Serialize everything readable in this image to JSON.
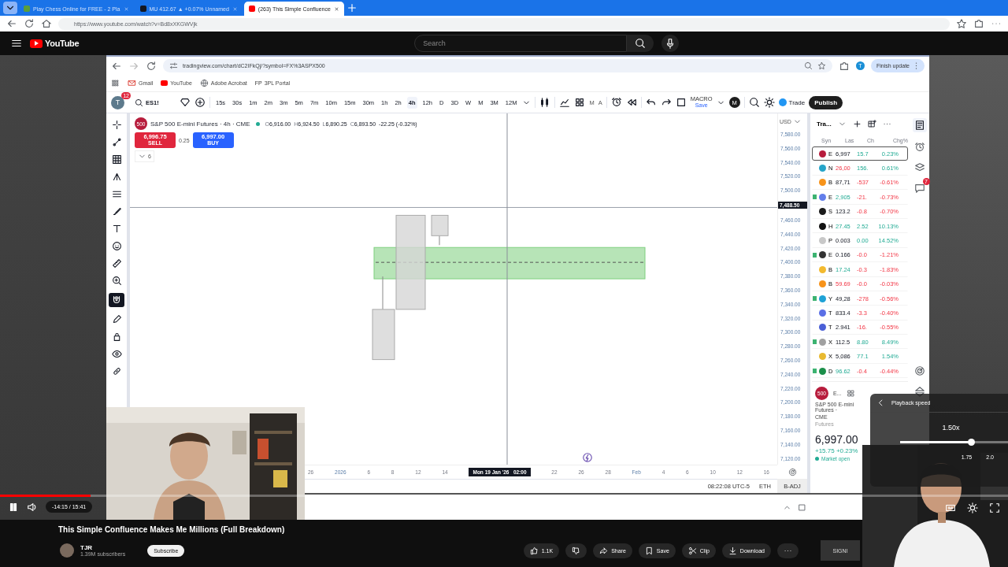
{
  "browser": {
    "tabs": [
      {
        "title": "Play Chess Online for FREE - 2 Pla",
        "selected": false
      },
      {
        "title": "MU 412.67 ▲ +0.07% Unnamed",
        "selected": false
      },
      {
        "title": "(263) This Simple Confluence",
        "selected": true
      }
    ],
    "url": "https://www.youtube.com/watch?v=Bd8xXKGWVjk"
  },
  "youtube": {
    "logo": "YouTube",
    "search_placeholder": "Search"
  },
  "screen": {
    "url": "tradingview.com/chart/dC2IFkQj/?symbol=FX%3ASPX500",
    "avatar": "T",
    "update_button": "Finish update",
    "bookmarks": [
      {
        "kind": "gmail",
        "label": "Gmail"
      },
      {
        "kind": "youtube",
        "label": "YouTube"
      },
      {
        "kind": "globe",
        "label": "Adobe Acrobat"
      },
      {
        "kind": "letters",
        "mark": "FP",
        "label": "3PL Portal"
      }
    ],
    "tv": {
      "avatar": "T",
      "notifications": "12",
      "symbol": "ES1!",
      "intervals": [
        {
          "label": "15s",
          "selected": false
        },
        {
          "label": "30s",
          "selected": false
        },
        {
          "label": "1m",
          "selected": false
        },
        {
          "label": "2m",
          "selected": false
        },
        {
          "label": "3m",
          "selected": false
        },
        {
          "label": "5m",
          "selected": false
        },
        {
          "label": "7m",
          "selected": false
        },
        {
          "label": "10m",
          "selected": false
        },
        {
          "label": "15m",
          "selected": false
        },
        {
          "label": "30m",
          "selected": false
        },
        {
          "label": "1h",
          "selected": false
        },
        {
          "label": "2h",
          "selected": false
        },
        {
          "label": "4h",
          "selected": true
        },
        {
          "label": "12h",
          "selected": false
        },
        {
          "label": "D",
          "selected": false
        },
        {
          "label": "3D",
          "selected": false
        },
        {
          "label": "W",
          "selected": false
        },
        {
          "label": "M",
          "selected": false
        },
        {
          "label": "3M",
          "selected": false
        },
        {
          "label": "12M",
          "selected": false
        }
      ],
      "tool_letters": [
        "M",
        "A"
      ],
      "layout": {
        "name": "MACRO",
        "state": "Save"
      },
      "user_initial": "M",
      "trade": "Trade",
      "publish": "Publish",
      "magnet_on": true,
      "legend": {
        "logo": "500",
        "title": "S&P 500 E-mini Futures · 4h · CME",
        "ohlc": [
          {
            "label": "O",
            "value": "6,916.00"
          },
          {
            "label": "H",
            "value": "6,924.50"
          },
          {
            "label": "L",
            "value": "6,890.25"
          },
          {
            "label": "C",
            "value": "6,893.50"
          }
        ],
        "change": "-22.25 (-0.32%)",
        "sell": {
          "price": "6,996.75",
          "label": "SELL"
        },
        "spread": "0.25",
        "buy": {
          "price": "6,997.00",
          "label": "BUY"
        },
        "indicators": "6"
      },
      "price_axis": {
        "currency": "USD",
        "labels": [
          {
            "text": "7,580.00",
            "kind": "tick"
          },
          {
            "text": "7,560.00",
            "kind": "tick"
          },
          {
            "text": "7,540.00",
            "kind": "tick"
          },
          {
            "text": "7,520.00",
            "kind": "tick"
          },
          {
            "text": "7,500.00",
            "kind": "tick"
          },
          {
            "text": "7,488.50",
            "kind": "cursor"
          },
          {
            "text": "7,460.00",
            "kind": "tick"
          },
          {
            "text": "7,440.00",
            "kind": "tick"
          },
          {
            "text": "7,420.00",
            "kind": "tick"
          },
          {
            "text": "7,400.00",
            "kind": "tick"
          },
          {
            "text": "7,380.00",
            "kind": "tick"
          },
          {
            "text": "7,360.00",
            "kind": "tick"
          },
          {
            "text": "7,340.00",
            "kind": "tick"
          },
          {
            "text": "7,320.00",
            "kind": "tick"
          },
          {
            "text": "7,300.00",
            "kind": "tick"
          },
          {
            "text": "7,280.00",
            "kind": "tick"
          },
          {
            "text": "7,260.00",
            "kind": "tick"
          },
          {
            "text": "7,240.00",
            "kind": "tick"
          },
          {
            "text": "7,220.00",
            "kind": "tick"
          },
          {
            "text": "7,200.00",
            "kind": "tick"
          },
          {
            "text": "7,180.00",
            "kind": "tick"
          },
          {
            "text": "7,160.00",
            "kind": "tick"
          },
          {
            "text": "7,140.00",
            "kind": "tick"
          },
          {
            "text": "7,120.00",
            "kind": "tick"
          }
        ]
      },
      "time_axis": [
        {
          "text": "26",
          "kind": "day"
        },
        {
          "text": "2026",
          "kind": "period"
        },
        {
          "text": "6",
          "kind": "day"
        },
        {
          "text": "8",
          "kind": "day"
        },
        {
          "text": "12",
          "kind": "day"
        },
        {
          "text": "14",
          "kind": "day"
        },
        {
          "text": "Mon 19 Jan '26   02:00",
          "kind": "cursor"
        },
        {
          "text": "22",
          "kind": "day"
        },
        {
          "text": "26",
          "kind": "day"
        },
        {
          "text": "28",
          "kind": "day"
        },
        {
          "text": "Feb",
          "kind": "period"
        },
        {
          "text": "4",
          "kind": "day"
        },
        {
          "text": "6",
          "kind": "day"
        },
        {
          "text": "10",
          "kind": "day"
        },
        {
          "text": "12",
          "kind": "day"
        },
        {
          "text": "16",
          "kind": "day"
        }
      ],
      "status": {
        "clock": "08:22:08 UTC-5",
        "session": "ETH",
        "adjust": "B-ADJ"
      },
      "watchlist": {
        "name": "Tra...",
        "columns": [
          "Syn",
          "Las",
          "Ch",
          "Chg%"
        ],
        "rows": [
          {
            "symbol": "E",
            "last": "6,997",
            "change": "15.7",
            "percent": "0.23%",
            "negative": false,
            "last_up": false,
            "last_down": false,
            "color": "#b71c3c",
            "flagged": false,
            "selected": true
          },
          {
            "symbol": "N",
            "last": "26,00",
            "change": "156.",
            "percent": "0.61%",
            "negative": false,
            "last_up": false,
            "last_down": true,
            "color": "#26a5c9",
            "flagged": false,
            "selected": false
          },
          {
            "symbol": "B",
            "last": "87,71",
            "change": "-537",
            "percent": "-0.61%",
            "negative": true,
            "last_up": false,
            "last_down": false,
            "color": "#f7931a",
            "flagged": false,
            "selected": false
          },
          {
            "symbol": "E",
            "last": "2,905",
            "change": "-21.",
            "percent": "-0.73%",
            "negative": true,
            "last_up": true,
            "last_down": false,
            "color": "#627eea",
            "flagged": true,
            "selected": false
          },
          {
            "symbol": "S",
            "last": "123.2",
            "change": "-0.8",
            "percent": "-0.70%",
            "negative": true,
            "last_up": false,
            "last_down": false,
            "color": "#1a1a1a",
            "flagged": false,
            "selected": false
          },
          {
            "symbol": "H",
            "last": "27.45",
            "change": "2.52",
            "percent": "10.13%",
            "negative": false,
            "last_up": true,
            "last_down": false,
            "color": "#111111",
            "flagged": false,
            "selected": false
          },
          {
            "symbol": "P",
            "last": "0.003",
            "change": "0.00",
            "percent": "14.52%",
            "negative": false,
            "last_up": false,
            "last_down": false,
            "color": "#c8c8c8",
            "flagged": false,
            "selected": false
          },
          {
            "symbol": "E",
            "last": "0.166",
            "change": "-0.0",
            "percent": "-1.21%",
            "negative": true,
            "last_up": false,
            "last_down": false,
            "color": "#333333",
            "flagged": true,
            "selected": false
          },
          {
            "symbol": "B",
            "last": "17.24",
            "change": "-0.3",
            "percent": "-1.83%",
            "negative": true,
            "last_up": true,
            "last_down": false,
            "color": "#f3ba2f",
            "flagged": false,
            "selected": false
          },
          {
            "symbol": "B",
            "last": "59.69",
            "change": "-0.0",
            "percent": "-0.03%",
            "negative": true,
            "last_up": false,
            "last_down": true,
            "color": "#f7931a",
            "flagged": false,
            "selected": false
          },
          {
            "symbol": "Y",
            "last": "49,28",
            "change": "-278",
            "percent": "-0.56%",
            "negative": true,
            "last_up": false,
            "last_down": false,
            "color": "#1ea2d6",
            "flagged": true,
            "selected": false
          },
          {
            "symbol": "T",
            "last": "833.4",
            "change": "-3.3",
            "percent": "-0.40%",
            "negative": true,
            "last_up": false,
            "last_down": false,
            "color": "#5a6fe6",
            "flagged": false,
            "selected": false
          },
          {
            "symbol": "T",
            "last": "2.941",
            "change": "-16.",
            "percent": "-0.55%",
            "negative": true,
            "last_up": false,
            "last_down": false,
            "color": "#4a5fd6",
            "flagged": false,
            "selected": false
          },
          {
            "symbol": "X",
            "last": "112.5",
            "change": "8.80",
            "percent": "8.49%",
            "negative": false,
            "last_up": false,
            "last_down": false,
            "color": "#a0a0a0",
            "flagged": true,
            "selected": false
          },
          {
            "symbol": "X",
            "last": "5,086",
            "change": "77.1",
            "percent": "1.54%",
            "negative": false,
            "last_up": false,
            "last_down": false,
            "color": "#e8b930",
            "flagged": false,
            "selected": false
          },
          {
            "symbol": "D",
            "last": "96.62",
            "change": "-0.4",
            "percent": "-0.44%",
            "negative": true,
            "last_up": true,
            "last_down": false,
            "color": "#1b8f4a",
            "flagged": true,
            "selected": false
          }
        ],
        "detail": {
          "logo": "500",
          "symbol": "E...",
          "name": "S&P 500 E-mini Futures ·",
          "exchange": "CME",
          "type": "Futures",
          "price": "6,997.00",
          "change": "+15.75 +0.23%",
          "status": "Market open"
        }
      },
      "chat_badge": "7"
    }
  },
  "player": {
    "progress": {
      "level": 0.09
    },
    "time": "-14:15 / 15:41",
    "speed_menu": {
      "title": "Playback speed",
      "value": "1.50x",
      "level": 0.66,
      "marks": [
        "1.75",
        "2.0"
      ]
    }
  },
  "info": {
    "title": "This Simple Confluence Makes Me Millions (Full Breakdown)",
    "channel": "TJR",
    "subscribers": "1.39M subscribers",
    "subscribe": "Subscribe",
    "likes": "1.1K",
    "actions": [
      {
        "kind": "share",
        "label": "Share"
      },
      {
        "kind": "save",
        "label": "Save"
      },
      {
        "kind": "clip",
        "label": "Clip"
      },
      {
        "kind": "download",
        "label": "Download"
      }
    ],
    "ad": "SIGNI"
  }
}
